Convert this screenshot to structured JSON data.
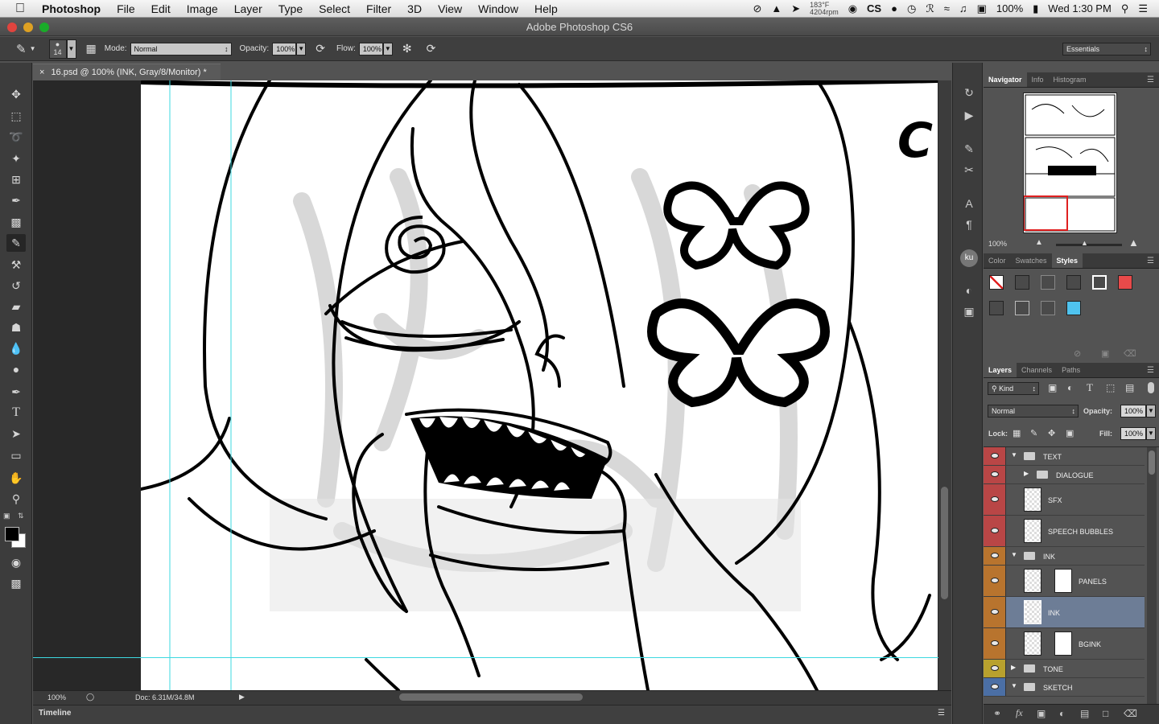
{
  "menubar": {
    "app_name": "Photoshop",
    "items": [
      "File",
      "Edit",
      "Image",
      "Layer",
      "Type",
      "Select",
      "Filter",
      "3D",
      "View",
      "Window",
      "Help"
    ],
    "status_temp": "183°F",
    "status_rpm": "4204rpm",
    "status_cs": "CS",
    "battery": "100%",
    "clock": "Wed 1:30 PM"
  },
  "window": {
    "title": "Adobe Photoshop CS6"
  },
  "options": {
    "brush_size": "14",
    "mode_label": "Mode:",
    "mode_value": "Normal",
    "opacity_label": "Opacity:",
    "opacity_value": "100%",
    "flow_label": "Flow:",
    "flow_value": "100%",
    "workspace": "Essentials"
  },
  "document": {
    "tab_title": "16.psd @ 100% (INK, Gray/8/Monitor) *",
    "canvas_text": "C",
    "zoom": "100%",
    "doc_size": "Doc: 6.31M/34.8M"
  },
  "timeline": {
    "label": "Timeline"
  },
  "navigator": {
    "tabs": [
      "Navigator",
      "Info",
      "Histogram"
    ],
    "zoom": "100%"
  },
  "color_panel": {
    "tabs": [
      "Color",
      "Swatches",
      "Styles"
    ],
    "style_swatches": [
      "none",
      "dark",
      "outline",
      "dark",
      "white-outline",
      "red",
      "dark",
      "outline",
      "dark",
      "blue"
    ],
    "colors": {
      "red": "#e84a4a",
      "blue": "#4fc3ef"
    }
  },
  "layers_panel": {
    "tabs": [
      "Layers",
      "Channels",
      "Paths"
    ],
    "kind_label": "Kind",
    "blend_mode": "Normal",
    "opacity_label": "Opacity:",
    "opacity_value": "100%",
    "lock_label": "Lock:",
    "fill_label": "Fill:",
    "fill_value": "100%",
    "layers": [
      {
        "name": "TEXT",
        "type": "group",
        "expanded": true,
        "color": "#b94646"
      },
      {
        "name": "DIALOGUE",
        "type": "group",
        "expanded": false,
        "color": "#b94646"
      },
      {
        "name": "SFX",
        "type": "layer",
        "color": "#b94646"
      },
      {
        "name": "SPEECH BUBBLES",
        "type": "layer",
        "color": "#b94646"
      },
      {
        "name": "INK",
        "type": "group",
        "expanded": true,
        "color": "#b8742e"
      },
      {
        "name": "PANELS",
        "type": "layer",
        "color": "#b8742e"
      },
      {
        "name": "INK",
        "type": "layer",
        "color": "#b8742e",
        "selected": true
      },
      {
        "name": "BGINK",
        "type": "layer",
        "color": "#b8742e"
      },
      {
        "name": "TONE",
        "type": "group",
        "expanded": false,
        "color": "#b8a12e"
      },
      {
        "name": "SKETCH",
        "type": "group",
        "expanded": true,
        "color": "#4b6fa5"
      }
    ]
  }
}
